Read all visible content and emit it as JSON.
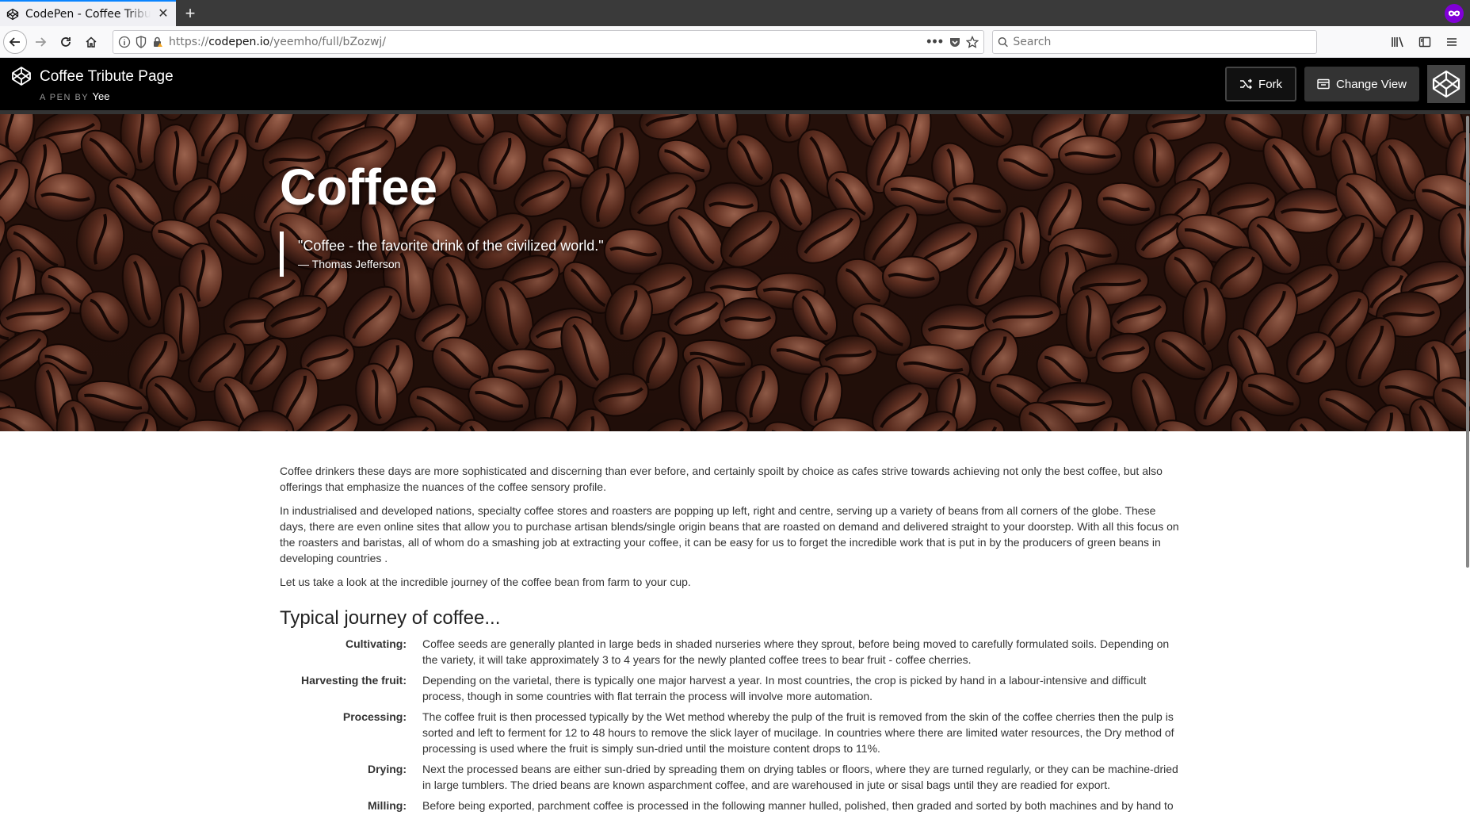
{
  "browser": {
    "tab_title": "CodePen - Coffee Tribute Page",
    "url_prefix": "https://",
    "url_host": "codepen.io",
    "url_path": "/yeemho/full/bZozwj/",
    "search_placeholder": "Search"
  },
  "codepen": {
    "title": "Coffee Tribute Page",
    "byline_prefix": "A PEN BY",
    "author": "Yee",
    "fork_label": "Fork",
    "change_view_label": "Change View"
  },
  "hero": {
    "title": "Coffee",
    "quote": "\"Coffee - the favorite drink of the civilized world.\"",
    "attribution": "— Thomas Jefferson"
  },
  "content": {
    "paragraphs": [
      "Coffee drinkers these days are more sophisticated and discerning than ever before, and certainly spoilt by choice as cafes strive towards achieving not only the best coffee, but also offerings that emphasize the nuances of the coffee sensory profile.",
      "In industrialised and developed nations, specialty coffee stores and roasters are popping up left, right and centre, serving up a variety of beans from all corners of the globe. These days, there are even online sites that allow you to purchase artisan blends/single origin beans that are roasted on demand and delivered straight to your doorstep. With all this focus on the roasters and baristas, all of whom do a smashing job at extracting your coffee, it can be easy for us to forget the incredible work that is put in by the producers of green beans in developing countries .",
      "Let us take a look at the incredible journey of the coffee bean from farm to your cup."
    ],
    "heading": "Typical journey of coffee...",
    "steps": [
      {
        "term": "Cultivating:",
        "desc": "Coffee seeds are generally planted in large beds in shaded nurseries where they sprout, before being moved to carefully formulated soils. Depending on the variety, it will take approximately 3 to 4 years for the newly planted coffee trees to bear fruit - coffee cherries."
      },
      {
        "term": "Harvesting the fruit:",
        "desc": "Depending on the varietal, there is typically one major harvest a year. In most countries, the crop is picked by hand in a labour-intensive and difficult process, though in some countries with flat terrain the process will involve more automation."
      },
      {
        "term": "Processing:",
        "desc": "The coffee fruit is then processed typically by the Wet method whereby the pulp of the fruit is removed from the skin of the coffee cherries then the pulp is sorted and left to ferment for 12 to 48 hours to remove the slick layer of mucilage. In countries where there are limited water resources, the Dry method of processing is used where the fruit is simply sun-dried until the moisture content drops to 11%."
      },
      {
        "term": "Drying:",
        "desc": "Next the processed beans are either sun-dried by spreading them on drying tables or floors, where they are turned regularly, or they can be machine-dried in large tumblers. The dried beans are known asparchment coffee, and are warehoused in jute or sisal bags until they are readied for export."
      },
      {
        "term": "Milling:",
        "desc": "Before being exported, parchment coffee is processed in the following manner hulled, polished, then graded and sorted by both machines and by hand to ensure only the best."
      }
    ]
  }
}
